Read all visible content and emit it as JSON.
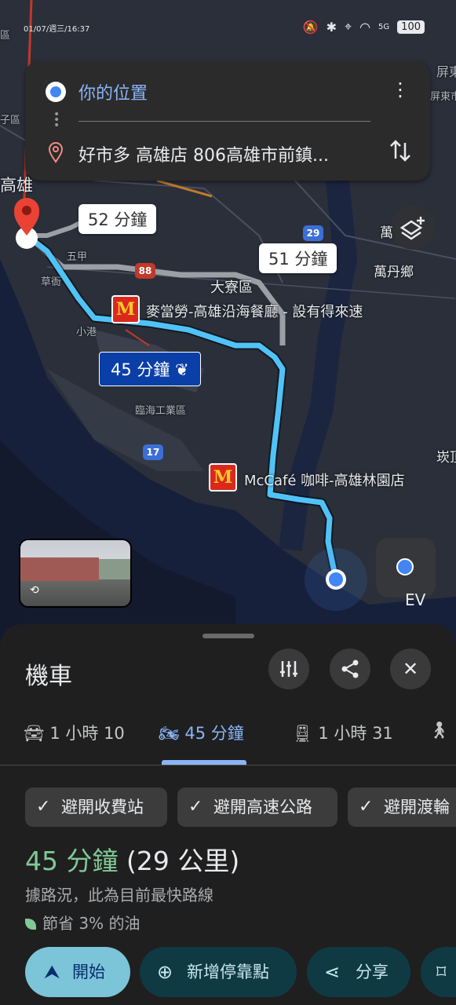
{
  "status_bar": {
    "time": "01/07/週三/16:37",
    "battery": "100",
    "network": "5G"
  },
  "route_card": {
    "origin": "你的位置",
    "destination": "好市多 高雄店 806高雄市前鎮..."
  },
  "map": {
    "route_labels": {
      "alt1": "52 分鐘",
      "alt2": "51 分鐘",
      "selected": "45 分鐘"
    },
    "places": {
      "kaohsiung": "高雄",
      "daliao": "大寮區",
      "wujia": "五甲",
      "caoya": "草衙",
      "xiaogang": "小港",
      "linhai": "臨海工業區",
      "wandan": "萬丹鄉",
      "pingdong": "屏東",
      "pingdong_city": "屏東市",
      "zone": "區",
      "zone2": "子區",
      "kuan": "崁頂",
      "ev": "EV",
      "side": "萬"
    },
    "pois": {
      "mcd1": "麥當勞-高雄沿海餐廳 - 設有得來速",
      "mcd2": "McCafé 咖啡-高雄林園店"
    },
    "road_shields": {
      "r29": "29",
      "r88": "88",
      "r17": "17"
    },
    "colors": {
      "route_selected": "#4fc3f7",
      "route_alt": "#9aa0a6",
      "destination_pin": "#ea4335"
    }
  },
  "sheet": {
    "title": "機車",
    "tabs": [
      {
        "label": "1 小時 10",
        "icon": "car-icon"
      },
      {
        "label": "45 分鐘",
        "icon": "motorcycle-icon"
      },
      {
        "label": "1 小時 31",
        "icon": "train-icon"
      },
      {
        "label": "",
        "icon": "walk-icon"
      }
    ],
    "chips": [
      "避開收費站",
      "避開高速公路",
      "避開渡輪"
    ],
    "duration_time": "45 分鐘",
    "duration_distance": "(29 公里)",
    "traffic_note": "據路況，此為目前最快路線",
    "fuel_note": "節省 3% 的油",
    "actions": {
      "start": "開始",
      "add_stop": "新增停靠點",
      "share": "分享"
    }
  }
}
